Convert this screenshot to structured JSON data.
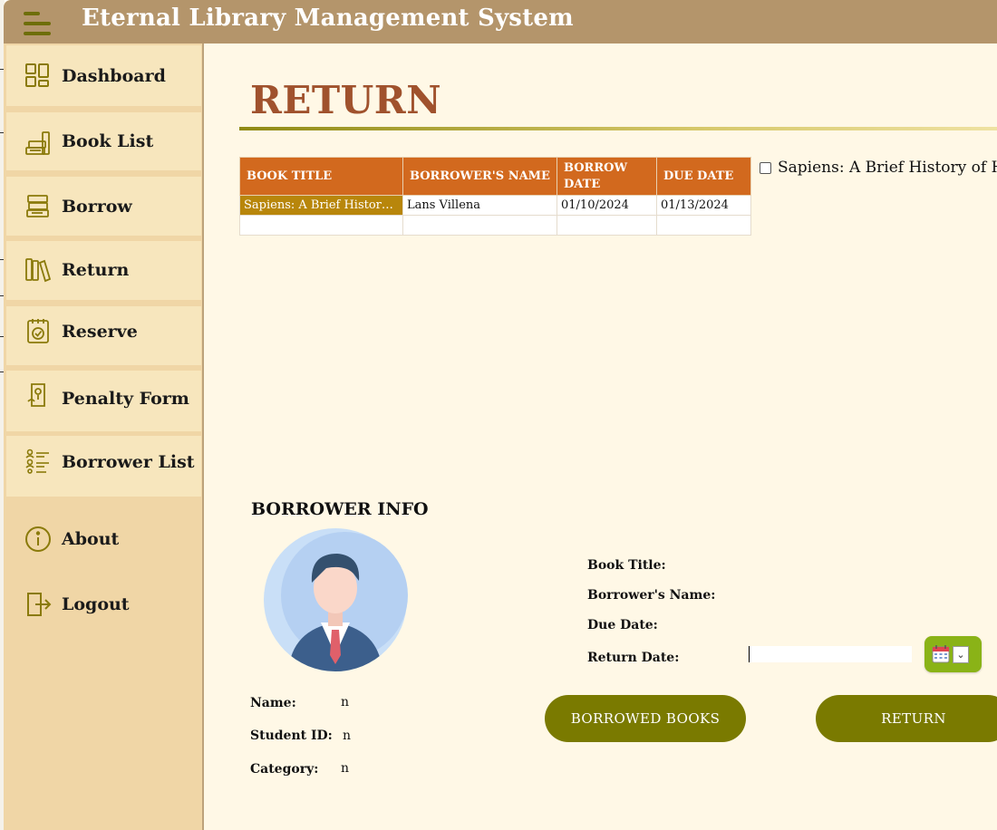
{
  "app": {
    "title": "Eternal Library Management System"
  },
  "sidebar": {
    "items": [
      {
        "label": "Dashboard",
        "icon": "dashboard-icon"
      },
      {
        "label": "Book List",
        "icon": "book-stack-icon"
      },
      {
        "label": "Borrow",
        "icon": "books-icon"
      },
      {
        "label": "Return",
        "icon": "bookshelf-icon"
      },
      {
        "label": "Reserve",
        "icon": "calendar-check-icon"
      },
      {
        "label": "Penalty Form",
        "icon": "penalty-icon"
      },
      {
        "label": "Borrower List",
        "icon": "people-list-icon"
      },
      {
        "label": "About",
        "icon": "info-icon"
      },
      {
        "label": "Logout",
        "icon": "logout-icon"
      }
    ]
  },
  "page": {
    "title": "RETURN"
  },
  "table": {
    "headers": [
      "BOOK TITLE",
      "BORROWER'S NAME",
      "BORROW DATE",
      "DUE DATE"
    ],
    "rows": [
      [
        "Sapiens: A Brief History of Humankind",
        "Lans Villena",
        "01/10/2024",
        "01/13/2024"
      ]
    ]
  },
  "book_checklist": {
    "item": "Sapiens: A Brief History of H"
  },
  "borrower_info": {
    "heading": "BORROWER INFO",
    "name_label": "Name:",
    "name_value": "n",
    "student_id_label": "Student ID:",
    "student_id_value": "n",
    "category_label": "Category:",
    "category_value": "n"
  },
  "details": {
    "book_title_label": "Book Title:",
    "borrower_name_label": "Borrower's Name:",
    "due_date_label": "Due Date:",
    "return_date_label": "Return Date:",
    "return_date_value": ""
  },
  "buttons": {
    "borrowed_books": "BORROWED BOOKS",
    "return": "RETURN"
  },
  "colors": {
    "titlebar": "#b4956b",
    "sidebar": "#f0d6a6",
    "main_bg": "#fff8e6",
    "accent_title": "#a0522d",
    "table_header": "#d2691e",
    "selected_cell": "#b8860b",
    "button": "#7a7a00",
    "date_button": "#8ab317",
    "icon": "#8a7a0a"
  }
}
